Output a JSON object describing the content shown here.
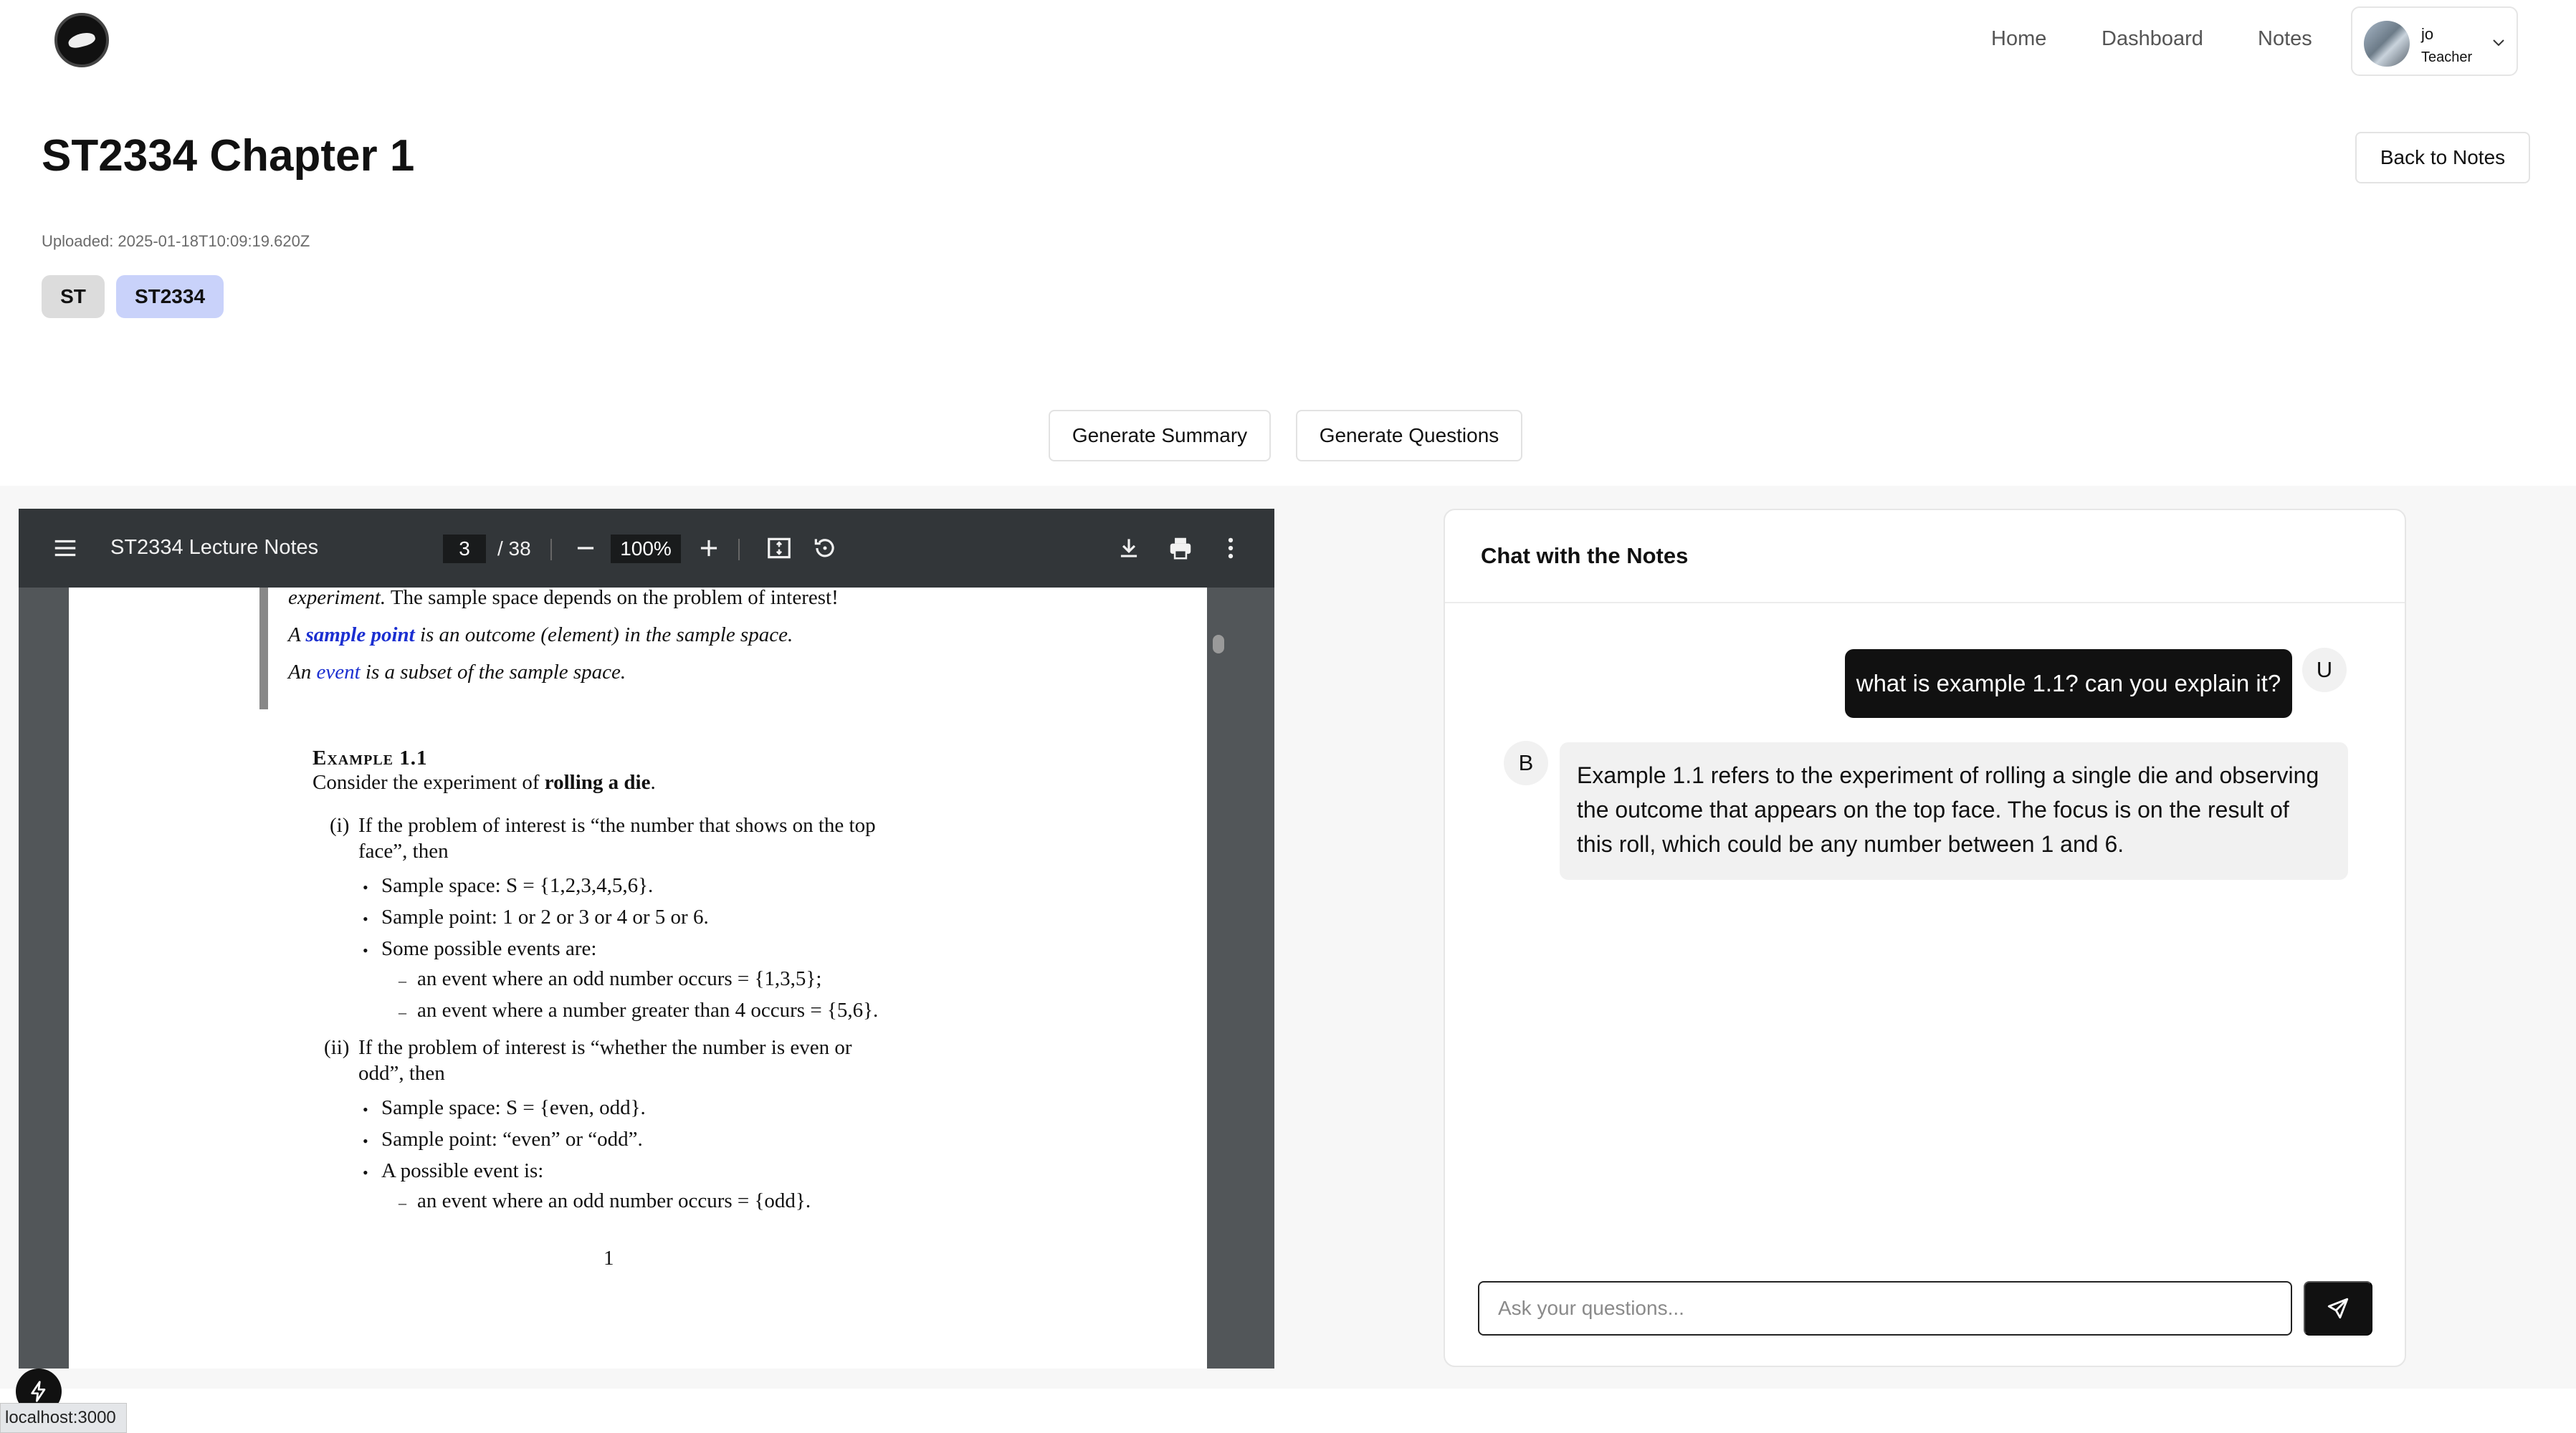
{
  "nav": {
    "home": "Home",
    "dashboard": "Dashboard",
    "notes": "Notes",
    "user_name": "jo",
    "user_role": "Teacher"
  },
  "header": {
    "title": "ST2334 Chapter 1",
    "back_label": "Back to Notes",
    "uploaded": "Uploaded: 2025-01-18T10:09:19.620Z",
    "tags": [
      "ST",
      "ST2334"
    ]
  },
  "actions": {
    "summary_label": "Generate Summary",
    "questions_label": "Generate Questions"
  },
  "pdf": {
    "title": "ST2334 Lecture Notes",
    "current_page": "3",
    "total_pages": "/ 38",
    "zoom": "100%",
    "content": {
      "l1a": "experiment.",
      "l1b": " The sample space depends on the problem of interest!",
      "l2a": "A ",
      "l2b": "sample point",
      "l2c": " is an outcome (element) in the sample space.",
      "l3a": "An ",
      "l3b": "event",
      "l3c": " is a subset of the sample space.",
      "example_heading": "Example 1.1",
      "ex_a": "Consider the experiment of ",
      "ex_b": "rolling a die",
      "ex_c": ".",
      "i_num": "(i)",
      "i_line1": "If the problem of interest is “the number that shows on the top",
      "i_line2": "face”, then",
      "i_b1": "Sample space: S = {1,2,3,4,5,6}.",
      "i_b2": "Sample point: 1 or 2 or 3 or 4 or 5 or 6.",
      "i_b3": "Some possible events are:",
      "i_s1": "an event where an odd number occurs = {1,3,5};",
      "i_s2": "an event where a number greater than 4 occurs = {5,6}.",
      "ii_num": "(ii)",
      "ii_line1": "If the problem of interest is “whether the number is even or",
      "ii_line2": "odd”, then",
      "ii_b1": "Sample space: S = {even, odd}.",
      "ii_b2": "Sample point: “even” or “odd”.",
      "ii_b3": "A possible event is:",
      "ii_s1": "an event where an odd number occurs = {odd}.",
      "page_number": "1"
    }
  },
  "chat": {
    "title": "Chat with the Notes",
    "user_avatar": "U",
    "bot_avatar": "B",
    "user_message": "what is example 1.1? can you explain it?",
    "bot_message": "Example 1.1 refers to the experiment of rolling a single die and observing the outcome that appears on the top face. The focus is on the result of this roll, which could be any number between 1 and 6.",
    "input_placeholder": "Ask your questions..."
  },
  "status": {
    "url": "localhost:3000"
  },
  "icons": {
    "menu": "menu-icon",
    "zoom_out": "minus-icon",
    "zoom_in": "plus-icon",
    "fit": "fit-page-icon",
    "rotate": "rotate-icon",
    "download": "download-icon",
    "print": "print-icon",
    "more": "more-vertical-icon",
    "send": "send-icon",
    "chevron": "chevron-down-icon",
    "devtools": "lightning-icon"
  },
  "colors": {
    "accent_dark": "#111111",
    "tag_primary": "#c9d2fa",
    "tag_secondary": "#dcdcdc",
    "pdf_toolbar": "#323639",
    "pdf_bg": "#525659",
    "pdf_link": "#1b2fd1"
  }
}
